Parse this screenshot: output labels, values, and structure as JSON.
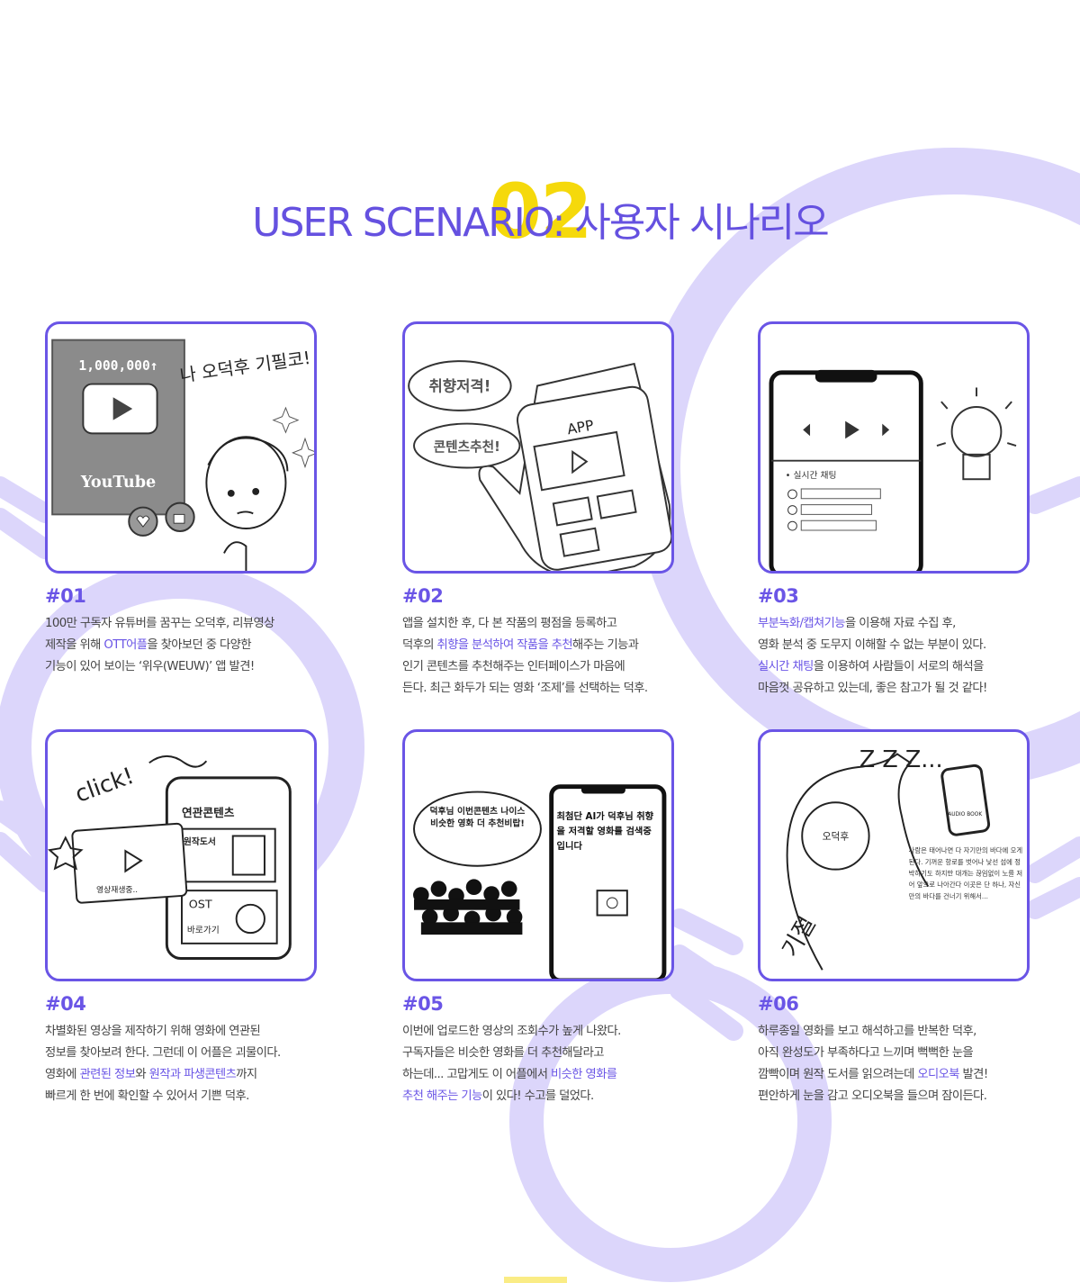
{
  "header": {
    "number": "02",
    "title": "USER SCENARIO: 사용자 시나리오"
  },
  "colors": {
    "accent": "#6a55e6",
    "yellow": "#f5d90b",
    "deco": "#dcd6fb"
  },
  "scenarios": [
    {
      "num": "#01",
      "lines": [
        [
          {
            "t": "100만 구독자 유튜버를 꿈꾸는 오덕후, 리뷰영상"
          }
        ],
        [
          {
            "t": "제작을 위해 "
          },
          {
            "t": "OTT어플",
            "h": true
          },
          {
            "t": "을 찾아보던 중 다양한"
          }
        ],
        [
          {
            "t": "기능이 있어 보이는 ‘위우(WEUW)’ 앱 발견!"
          }
        ]
      ],
      "illustration": {
        "counter": "1,000,000↑",
        "brand": "YouTube",
        "handwriting": "나 오덕후 기필코!"
      }
    },
    {
      "num": "#02",
      "lines": [
        [
          {
            "t": "앱을 설치한 후, 다 본 작품의 평점을 등록하고"
          }
        ],
        [
          {
            "t": "덕후의 "
          },
          {
            "t": "취향을 분석하여 작품을 추천",
            "h": true
          },
          {
            "t": "해주는 기능과"
          }
        ],
        [
          {
            "t": "인기 콘텐츠를 추천해주는 인터페이스가 마음에"
          }
        ],
        [
          {
            "t": "든다. 최근 화두가 되는 영화 ‘조제’를 선택하는 덕후."
          }
        ]
      ],
      "illustration": {
        "bubble1": "취향저격!",
        "bubble2": "콘텐츠추천!",
        "screen": "APP"
      }
    },
    {
      "num": "#03",
      "lines": [
        [
          {
            "t": "부분녹화/캡쳐기능",
            "h": true
          },
          {
            "t": "을 이용해 자료 수집 후,"
          }
        ],
        [
          {
            "t": "영화 분석 중 도무지 이해할 수 없는 부분이 있다."
          }
        ],
        [
          {
            "t": "실시간 채팅",
            "h": true
          },
          {
            "t": "을 이용하여 사람들이 서로의 해석을"
          }
        ],
        [
          {
            "t": "마음껏 공유하고 있는데, 좋은 참고가 될 것 같다!"
          }
        ]
      ],
      "illustration": {
        "chat_label": "• 실시간 채팅"
      }
    },
    {
      "num": "#04",
      "lines": [
        [
          {
            "t": "차별화된 영상을 제작하기 위해 영화에 연관된"
          }
        ],
        [
          {
            "t": "정보를 찾아보려 한다. 그런데 이 어플은 괴물이다."
          }
        ],
        [
          {
            "t": "영화에 "
          },
          {
            "t": "관련된 정보",
            "h": true
          },
          {
            "t": "와 "
          },
          {
            "t": "원작과 파생콘텐츠",
            "h": true
          },
          {
            "t": "까지"
          }
        ],
        [
          {
            "t": "빠르게 한 번에 확인할 수 있어서 기쁜 덕후."
          }
        ]
      ],
      "illustration": {
        "click": "click!",
        "panel_title": "연관콘텐츠",
        "book": "원작도서",
        "ost": "OST",
        "ost_btn": "바로가기",
        "video": "영상재생중.."
      }
    },
    {
      "num": "#05",
      "lines": [
        [
          {
            "t": "이번에 업로드한 영상의 조회수가 높게 나왔다."
          }
        ],
        [
          {
            "t": "구독자들은 비슷한 영화를 더 추천해달라고"
          }
        ],
        [
          {
            "t": "하는데... 고맙게도 이 어플에서 "
          },
          {
            "t": "비슷한 영화를",
            "h": true
          }
        ],
        [
          {
            "t": "추천 해주는 기능",
            "h": true
          },
          {
            "t": "이 있다! 수고를 덜었다."
          }
        ]
      ],
      "illustration": {
        "bubble": "덕후님 이번콘텐츠 나이스 비슷한 영화 더 추천비랍!",
        "phone": "최첨단 AI가 덕후님 취향을 저격할 영화를 검색중입니다"
      }
    },
    {
      "num": "#06",
      "lines": [
        [
          {
            "t": "하루종일 영화를 보고 해석하고를 반복한 덕후,"
          }
        ],
        [
          {
            "t": "아직 완성도가 부족하다고 느끼며 뻑뻑한 눈을"
          }
        ],
        [
          {
            "t": "깜빡이며 원작 도서를 읽으려는데 "
          },
          {
            "t": "오디오북",
            "h": true
          },
          {
            "t": " 발견!"
          }
        ],
        [
          {
            "t": "편안하게 눈을 감고 오디오북을 들으며 잠이든다."
          }
        ]
      ],
      "illustration": {
        "zzz": "Z Z Z...",
        "label": "오덕후",
        "faint": "기절",
        "device": "AUDIO BOOK",
        "note": "사람은 태어나면 다 자기만의 바다에 오게 된다. 기꺼운 항로를 벗어나 낯선 섬에 정박하기도 하지만 대개는 끊임없이 노를 저어 앞으로 나아간다 이곳은 단 하나, 자신만의 바다를 건너기 위해서..."
      }
    }
  ]
}
